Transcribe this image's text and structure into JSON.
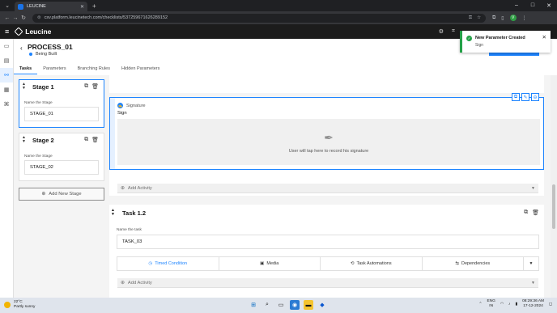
{
  "browser": {
    "tab_title": "LEUCINE",
    "url": "csv.platform.leucinetech.com/checklists/537259671626289152",
    "profile_initial": "V"
  },
  "app": {
    "logo_text": "Leucine"
  },
  "page": {
    "title": "PROCESS_01",
    "status": "Being Built",
    "tabs": [
      "Tasks",
      "Parameters",
      "Branching Rules",
      "Hidden Parameters"
    ]
  },
  "stages": {
    "items": [
      {
        "name": "Stage 1",
        "field_label": "Name the Stage",
        "field_value": "STAGE_01"
      },
      {
        "name": "Stage 2",
        "field_label": "Name the Stage",
        "field_value": "STAGE_02"
      }
    ],
    "add_label": "Add New Stage"
  },
  "signature": {
    "type_label": "Signature",
    "name": "Sign",
    "placeholder": "User will tap here to record his signature"
  },
  "add_activity_label": "Add Activity",
  "task": {
    "title": "Task 1.2",
    "field_label": "Name the task",
    "field_value": "TASK_03",
    "actions": [
      "Timed Condition",
      "Media",
      "Task Automations",
      "Dependencies"
    ]
  },
  "toast": {
    "title": "New Parameter Created",
    "message": "Sign"
  },
  "taskbar": {
    "temp": "22°C",
    "weather": "Partly sunny",
    "lang1": "ENG",
    "lang2": "IN",
    "time": "08:29:36 AM",
    "date": "17-12-2024"
  },
  "colors": {
    "accent": "#1d84ff",
    "success": "#24a148"
  }
}
